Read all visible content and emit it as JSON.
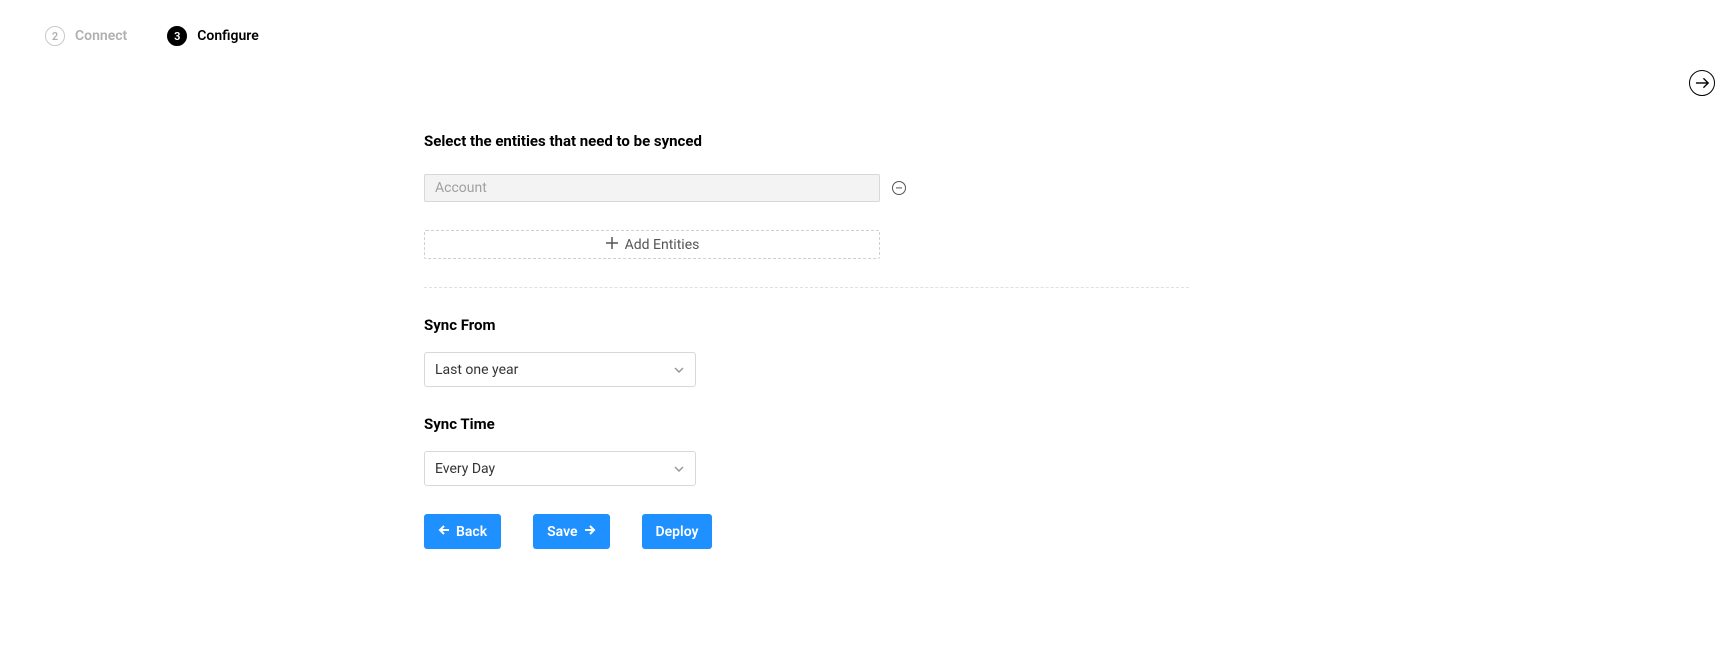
{
  "stepper": {
    "steps": [
      {
        "number": "2",
        "label": "Connect",
        "active": false
      },
      {
        "number": "3",
        "label": "Configure",
        "active": true
      }
    ]
  },
  "form": {
    "entities_heading": "Select the entities that need to be synced",
    "entity_placeholder": "Account",
    "add_entities_label": "Add Entities",
    "sync_from_label": "Sync From",
    "sync_from_value": "Last one year",
    "sync_time_label": "Sync Time",
    "sync_time_value": "Every Day"
  },
  "buttons": {
    "back": "Back",
    "save": "Save",
    "deploy": "Deploy"
  }
}
